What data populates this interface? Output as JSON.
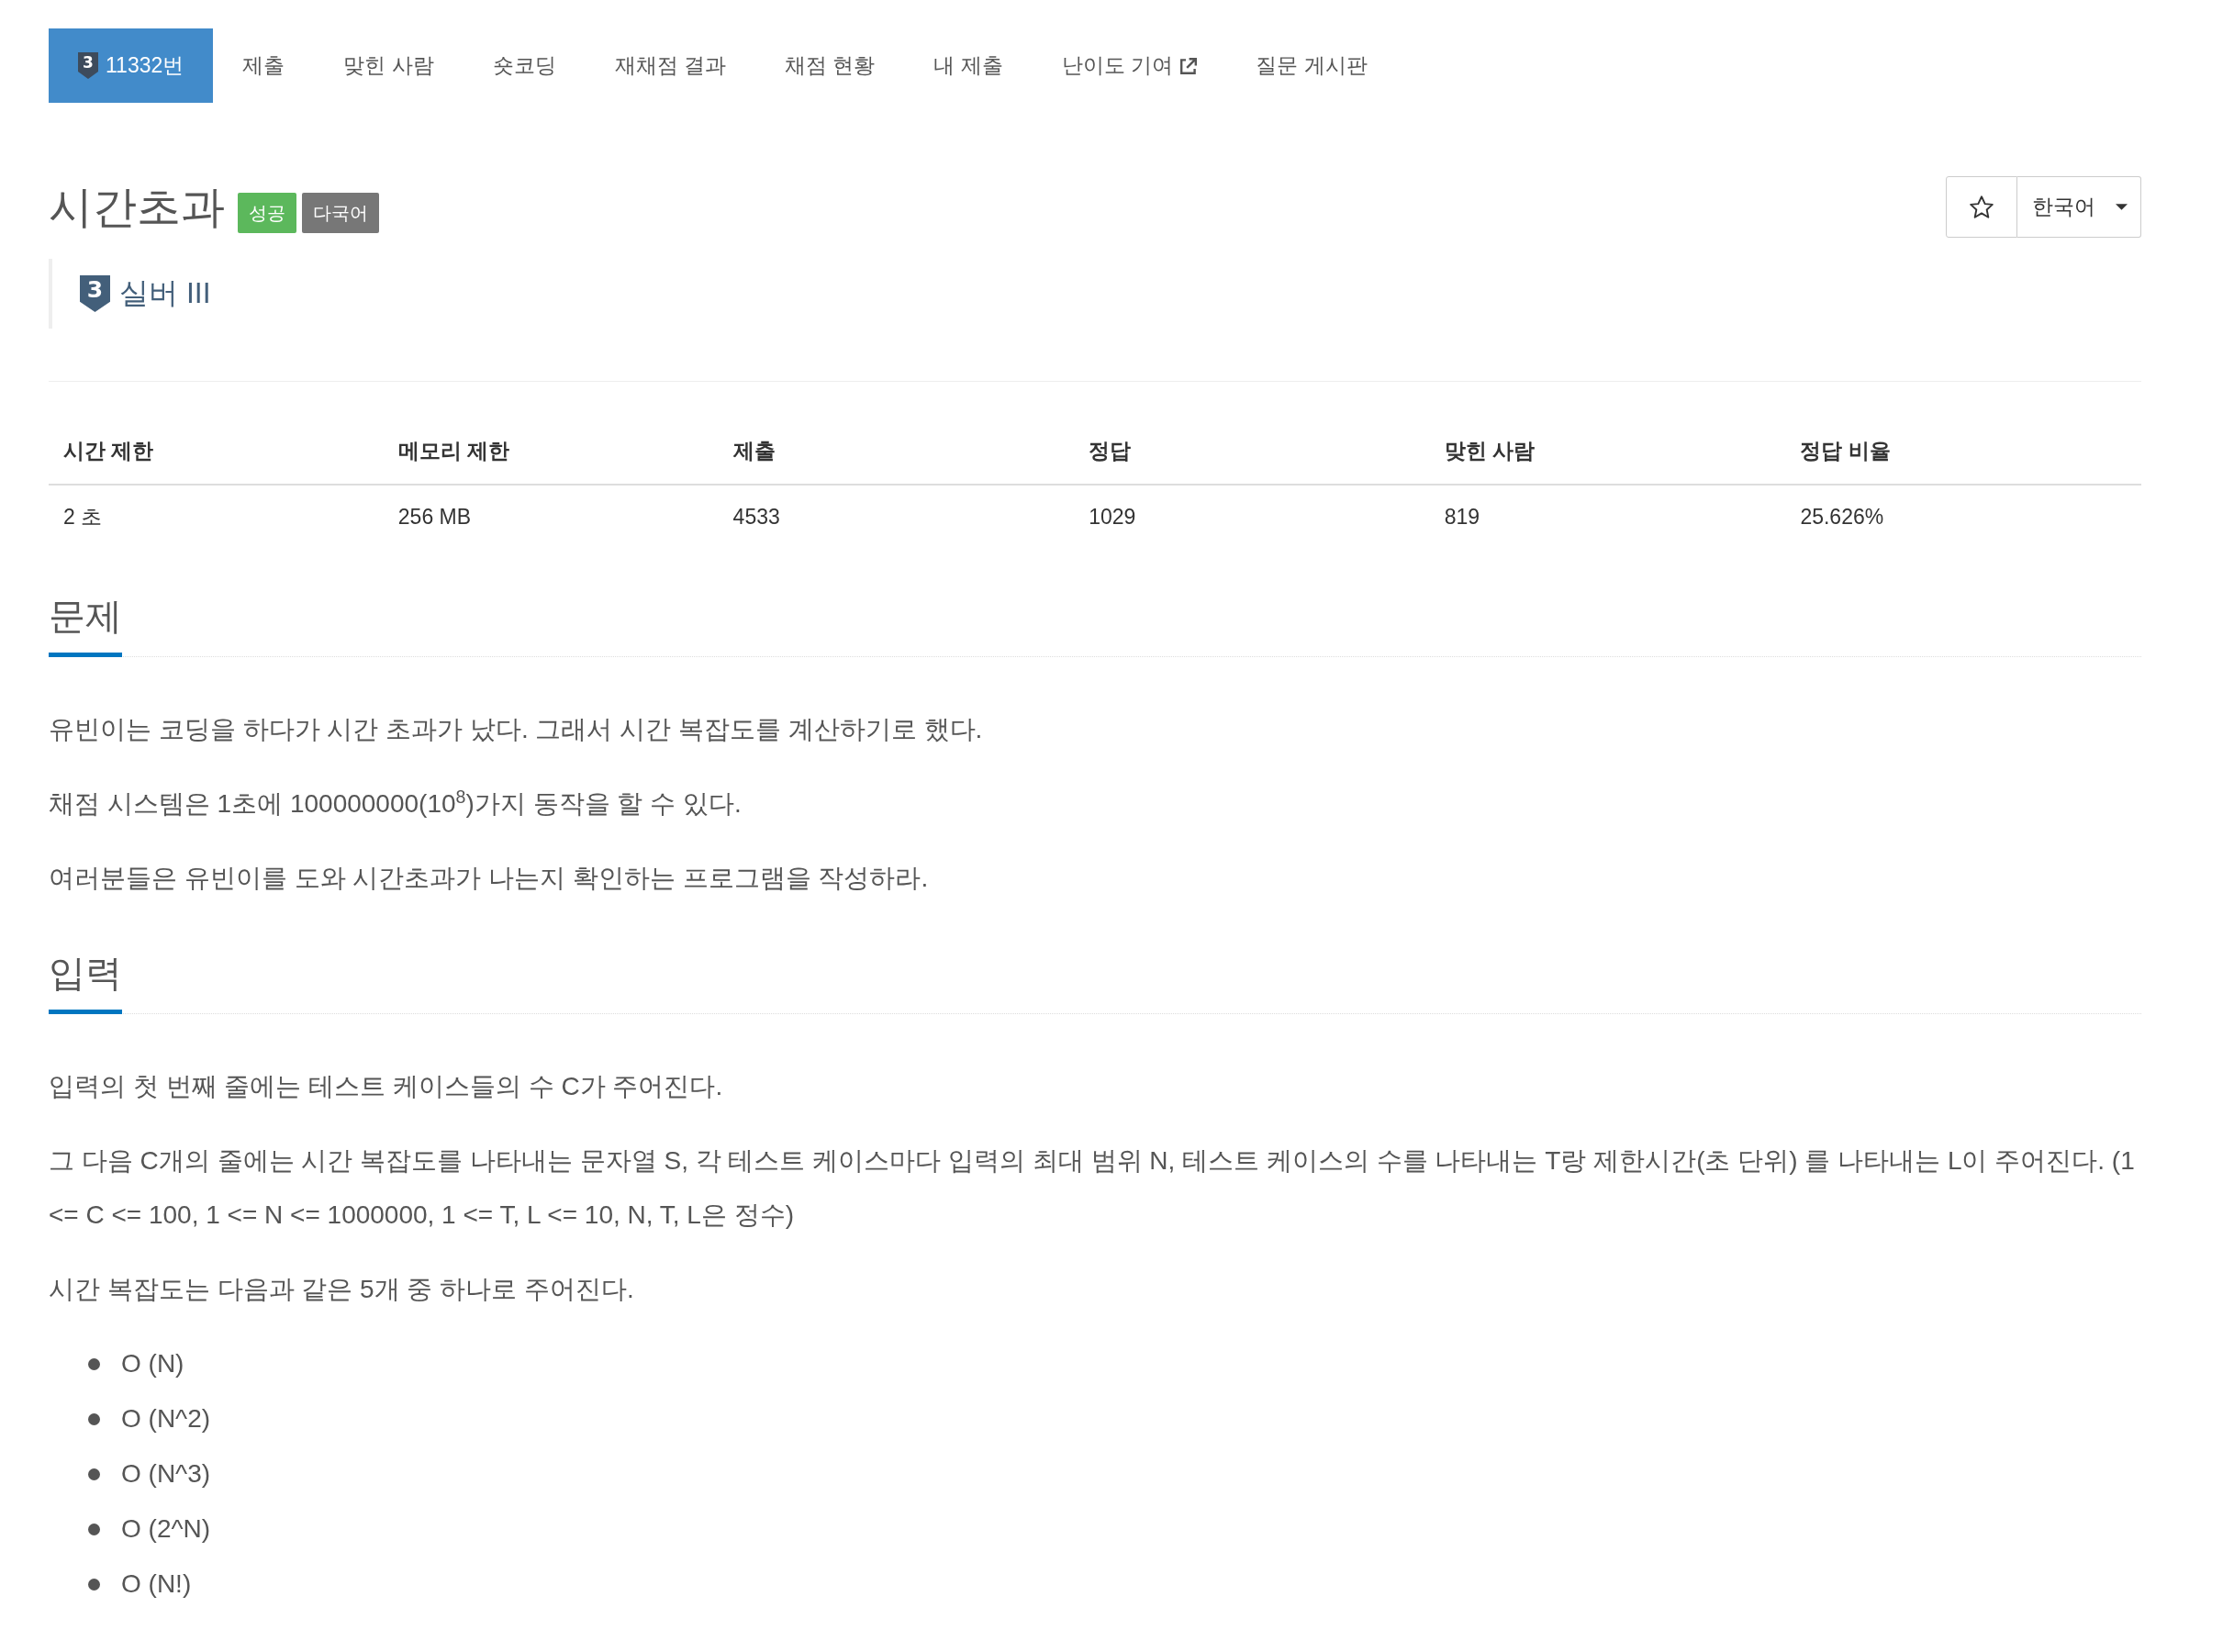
{
  "nav": {
    "tabs": [
      {
        "kind": "problem",
        "tier_digit": "3",
        "label": "11332번",
        "selected": true
      },
      {
        "kind": "link",
        "label": "제출",
        "selected": false
      },
      {
        "kind": "link",
        "label": "맞힌 사람",
        "selected": false
      },
      {
        "kind": "link",
        "label": "숏코딩",
        "selected": false
      },
      {
        "kind": "link",
        "label": "재채점 결과",
        "selected": false
      },
      {
        "kind": "link",
        "label": "채점 현황",
        "selected": false
      },
      {
        "kind": "link",
        "label": "내 제출",
        "selected": false
      },
      {
        "kind": "external",
        "label": "난이도 기여",
        "selected": false
      },
      {
        "kind": "link",
        "label": "질문 게시판",
        "selected": false
      }
    ]
  },
  "header": {
    "title": "시간초과",
    "badges": [
      {
        "label": "성공",
        "color": "#5cb85c"
      },
      {
        "label": "다국어",
        "color": "#777777"
      }
    ],
    "favorite": {
      "starred": false
    },
    "language": {
      "value": "한국어"
    }
  },
  "tier": {
    "digit": "3",
    "label": "실버 III"
  },
  "stats": {
    "columns": [
      "시간 제한",
      "메모리 제한",
      "제출",
      "정답",
      "맞힌 사람",
      "정답 비율"
    ],
    "rows": [
      [
        "2 초",
        "256 MB",
        "4533",
        "1029",
        "819",
        "25.626%"
      ]
    ]
  },
  "sections": [
    {
      "title": "문제",
      "paragraphs": [
        "유빈이는 코딩을 하다가 시간 초과가 났다. 그래서 시간 복잡도를 계산하기로 했다.",
        "채점 시스템은 1초에 100000000(10$^{8}$)가지 동작을 할 수 있다.",
        "여러분들은 유빈이를 도와 시간초과가 나는지 확인하는 프로그램을 작성하라."
      ]
    },
    {
      "title": "입력",
      "paragraphs": [
        "입력의 첫 번째 줄에는 테스트 케이스들의 수 C가 주어진다.",
        "그 다음 C개의 줄에는 시간 복잡도를 나타내는 문자열 S, 각 테스트 케이스마다 입력의 최대 범위 N, 테스트 케이스의 수를 나타내는 T랑 제한시간(초 단위) 를 나타내는 L이 주어진다. (1 <= C <= 100, 1 <= N <= 1000000, 1 <= T, L <= 10, N, T, L은 정수)",
        "시간 복잡도는 다음과 같은 5개 중 하나로 주어진다."
      ],
      "list": [
        "O (N)",
        "O (N^2)",
        "O (N^3)",
        "O (2^N)",
        "O (N!)"
      ]
    }
  ]
}
